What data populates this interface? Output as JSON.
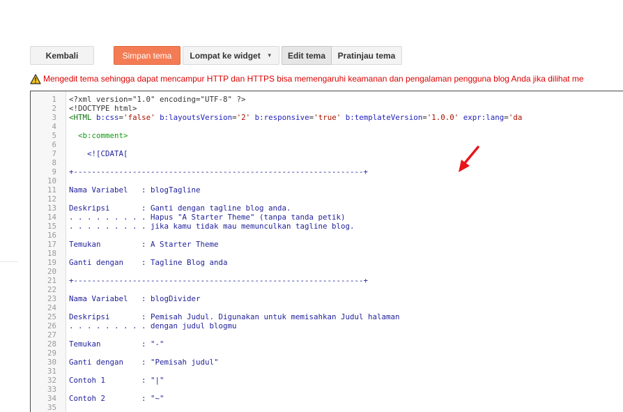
{
  "toolbar": {
    "back_label": "Kembali",
    "save_label": "Simpan tema",
    "jump_label": "Lompat ke widget",
    "edit_label": "Edit tema",
    "preview_label": "Pratinjau tema"
  },
  "warning": {
    "icon": "warning-triangle-icon",
    "text": "Mengedit tema sehingga dapat mencampur HTTP dan HTTPS bisa memengaruhi keamanan dan pengalaman pengguna blog Anda jika dilihat me"
  },
  "colors": {
    "save_button": "#f37c54",
    "warning_text": "#dd0000",
    "code_comment": "#22229a",
    "arrow": "#e8141b"
  },
  "editor": {
    "lines": [
      {
        "n": "1",
        "text": "<?xml version=\"1.0\" encoding=\"UTF-8\" ?>"
      },
      {
        "n": "2",
        "text": "<!DOCTYPE html>"
      },
      {
        "n": "3",
        "text": "<HTML b:css='false' b:layoutsVersion='2' b:responsive='true' b:templateVersion='1.0.0' expr:lang='da"
      },
      {
        "n": "4",
        "text": ""
      },
      {
        "n": "5",
        "text": "  <b:comment>"
      },
      {
        "n": "6",
        "text": ""
      },
      {
        "n": "7",
        "text": "    <![CDATA["
      },
      {
        "n": "8",
        "text": ""
      },
      {
        "n": "9",
        "text": "+----------------------------------------------------------------+"
      },
      {
        "n": "10",
        "text": ""
      },
      {
        "n": "11",
        "text": "Nama Variabel   : blogTagline"
      },
      {
        "n": "12",
        "text": ""
      },
      {
        "n": "13",
        "text": "Deskripsi       : Ganti dengan tagline blog anda."
      },
      {
        "n": "14",
        "text": ". . . . . . . . . Hapus \"A Starter Theme\" (tanpa tanda petik)"
      },
      {
        "n": "15",
        "text": ". . . . . . . . . jika kamu tidak mau memunculkan tagline blog."
      },
      {
        "n": "16",
        "text": ""
      },
      {
        "n": "17",
        "text": "Temukan         : A Starter Theme"
      },
      {
        "n": "18",
        "text": ""
      },
      {
        "n": "19",
        "text": "Ganti dengan    : Tagline Blog anda"
      },
      {
        "n": "20",
        "text": ""
      },
      {
        "n": "21",
        "text": "+----------------------------------------------------------------+"
      },
      {
        "n": "22",
        "text": ""
      },
      {
        "n": "23",
        "text": "Nama Variabel   : blogDivider"
      },
      {
        "n": "24",
        "text": ""
      },
      {
        "n": "25",
        "text": "Deskripsi       : Pemisah Judul. Digunakan untuk memisahkan Judul halaman"
      },
      {
        "n": "26",
        "text": ". . . . . . . . . dengan judul blogmu"
      },
      {
        "n": "27",
        "text": ""
      },
      {
        "n": "28",
        "text": "Temukan         : \"-\""
      },
      {
        "n": "29",
        "text": ""
      },
      {
        "n": "30",
        "text": "Ganti dengan    : \"Pemisah judul\""
      },
      {
        "n": "31",
        "text": ""
      },
      {
        "n": "32",
        "text": "Contoh 1        : \"|\""
      },
      {
        "n": "33",
        "text": ""
      },
      {
        "n": "34",
        "text": "Contoh 2        : \"~\""
      },
      {
        "n": "35",
        "text": ""
      }
    ]
  }
}
